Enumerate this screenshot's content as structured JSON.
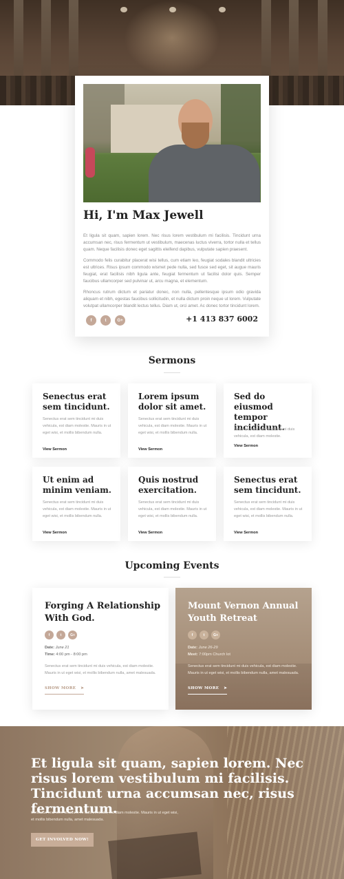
{
  "profile": {
    "name": "Hi, I'm Max Jewell",
    "paragraphs": [
      "Et ligula sit quam, sapien lorem. Nec risus lorem vestibulum mi facilisis. Tincidunt urna accumsan nec, risus fermentum ut vestibulum, maecenas luctus viverra, tortor nulla et tellus quam. Neque facilisis donec eget sagittis eleifend dapibus, vulputate sapien praesent.",
      "Commodo felis curabitur placerat wisi tellus, cum etiam leo, feugiat sodales blandit ultricies est ultrices. Risus ipsum commodo wismet pede nulla, sed fusce sed eget, sit augue mauris feugiat, erat facilisis nibh ligula ante, feugiat fermentum ut facilisi dolor quis. Semper faucibus ullamcorper sed pulvinar ut, arcu magna, et elementum.",
      "Rhoncus rutrum dictum et pariatur donec, non nulla, pellentesque ipsum odio gravida aliquam et nibh, egestas faucibus sollicitudin, et nulla dictum proin neque ut lorem. Vulputate volutpat ullamcorper blandit lectus tellus. Diam ut, orci amet. Ac donec tortor tincidunt lorem."
    ],
    "socials": [
      {
        "icon": "facebook-icon",
        "glyph": "f"
      },
      {
        "icon": "twitter-icon",
        "glyph": "t"
      },
      {
        "icon": "google-plus-icon",
        "glyph": "G+"
      }
    ],
    "phone": "+1 413 837 6002"
  },
  "sermons": {
    "title": "Sermons",
    "link_label": "View Sermon",
    "description": "Senectus erat sem tincidunt mi duis vehicula, est diam molestie. Mauris in ut eget wisi, et mollis bibendum nulla.",
    "description_short": "Senectus erat sem tincidunt mi duis vehicula, est diam molestie.",
    "items": [
      {
        "title": "Senectus erat sem tincidunt."
      },
      {
        "title": "Lorem ipsum dolor sit amet."
      },
      {
        "title": "Sed do eiusmod tempor incididunt."
      },
      {
        "title": "Ut enim ad minim veniam."
      },
      {
        "title": "Quis nostrud exercitation."
      },
      {
        "title": "Senectus erat sem tincidunt."
      }
    ]
  },
  "events": {
    "title": "Upcoming Events",
    "items": [
      {
        "title": "Forging A Relationship With God.",
        "date_label": "Date:",
        "date": "June 21",
        "time_label": "Time:",
        "time": "4:00 pm - 8:00 pm",
        "description": "Senectus erat sem tincidunt mi duis vehicula, est diam molestie. Mauris in ut eget wisi, et mollis bibendum nulla, amet malesuada.",
        "more": "SHOW MORE"
      },
      {
        "title": "Mount Vernon Annual Youth Retreat",
        "date_label": "Date:",
        "date": "June 26-29",
        "time_label": "Meet:",
        "time": "7:00pm Church lot",
        "description": "Senectus erat sem tincidunt mi duis vehicula, est diam molestie. Mauris in ut eget wisi, et mollis bibendum nulla, amet malesuada.",
        "more": "SHOW MORE"
      }
    ]
  },
  "banner": {
    "heading": "Et ligula sit quam, sapien lorem. Nec risus lorem vestibulum mi facilisis. Tincidunt urna accumsan nec, risus fermentum.",
    "text": "Senectus erat sem tincidunt mi duis vehicula, est diam molestie. Mauris in ut eget wisi, et mollis bibendum nulla, amet malesuada.",
    "button": "GET INVOLVED NOW!"
  },
  "colors": {
    "accent": "#c4a898",
    "heading": "#222222",
    "body_text": "#999999"
  }
}
